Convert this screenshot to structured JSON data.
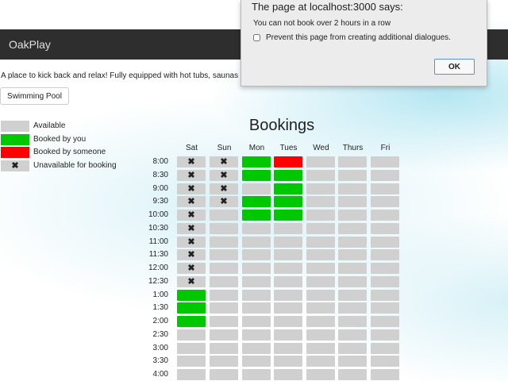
{
  "navbar": {
    "brand": "OakPlay"
  },
  "tagline": "A place to kick back and relax! Fully equipped with hot tubs, saunas",
  "facility_button": "Swimming Pool",
  "legend": [
    {
      "label": "Available",
      "color": "#d0d0d0",
      "icon": ""
    },
    {
      "label": "Booked by you",
      "color": "#00c800",
      "icon": ""
    },
    {
      "label": "Booked by someone",
      "color": "#ff0000",
      "icon": ""
    },
    {
      "label": "Unavailable for booking",
      "color": "#d0d0d0",
      "icon": "✖"
    }
  ],
  "bookings": {
    "title": "Bookings",
    "days": [
      "Sat",
      "Sun",
      "Mon",
      "Tues",
      "Wed",
      "Thurs",
      "Fri"
    ],
    "times": [
      "8:00",
      "8:30",
      "9:00",
      "9:30",
      "10:00",
      "10:30",
      "11:00",
      "11:30",
      "12:00",
      "12:30",
      "1:00",
      "1:30",
      "2:00",
      "2:30",
      "3:00",
      "3:30",
      "4:00"
    ],
    "status_codes": {
      "a": "available",
      "u": "unavailable",
      "y": "booked-by-you",
      "s": "booked-by-someone"
    },
    "status_colors": {
      "a": "#d0d0d0",
      "u": "#d0d0d0",
      "y": "#00c800",
      "s": "#ff0000"
    },
    "unavailable_icon": "✖",
    "grid": [
      [
        "u",
        "u",
        "y",
        "s",
        "a",
        "a",
        "a"
      ],
      [
        "u",
        "u",
        "y",
        "y",
        "a",
        "a",
        "a"
      ],
      [
        "u",
        "u",
        "a",
        "y",
        "a",
        "a",
        "a"
      ],
      [
        "u",
        "u",
        "y",
        "y",
        "a",
        "a",
        "a"
      ],
      [
        "u",
        "a",
        "y",
        "y",
        "a",
        "a",
        "a"
      ],
      [
        "u",
        "a",
        "a",
        "a",
        "a",
        "a",
        "a"
      ],
      [
        "u",
        "a",
        "a",
        "a",
        "a",
        "a",
        "a"
      ],
      [
        "u",
        "a",
        "a",
        "a",
        "a",
        "a",
        "a"
      ],
      [
        "u",
        "a",
        "a",
        "a",
        "a",
        "a",
        "a"
      ],
      [
        "u",
        "a",
        "a",
        "a",
        "a",
        "a",
        "a"
      ],
      [
        "y",
        "a",
        "a",
        "a",
        "a",
        "a",
        "a"
      ],
      [
        "y",
        "a",
        "a",
        "a",
        "a",
        "a",
        "a"
      ],
      [
        "y",
        "a",
        "a",
        "a",
        "a",
        "a",
        "a"
      ],
      [
        "a",
        "a",
        "a",
        "a",
        "a",
        "a",
        "a"
      ],
      [
        "a",
        "a",
        "a",
        "a",
        "a",
        "a",
        "a"
      ],
      [
        "a",
        "a",
        "a",
        "a",
        "a",
        "a",
        "a"
      ],
      [
        "a",
        "a",
        "a",
        "a",
        "a",
        "a",
        "a"
      ]
    ]
  },
  "dialog": {
    "title": "The page at localhost:3000 says:",
    "message": "You can not book over 2 hours in a row",
    "checkbox_label": "Prevent this page from creating additional dialogues.",
    "checkbox_checked": false,
    "ok_label": "OK"
  }
}
